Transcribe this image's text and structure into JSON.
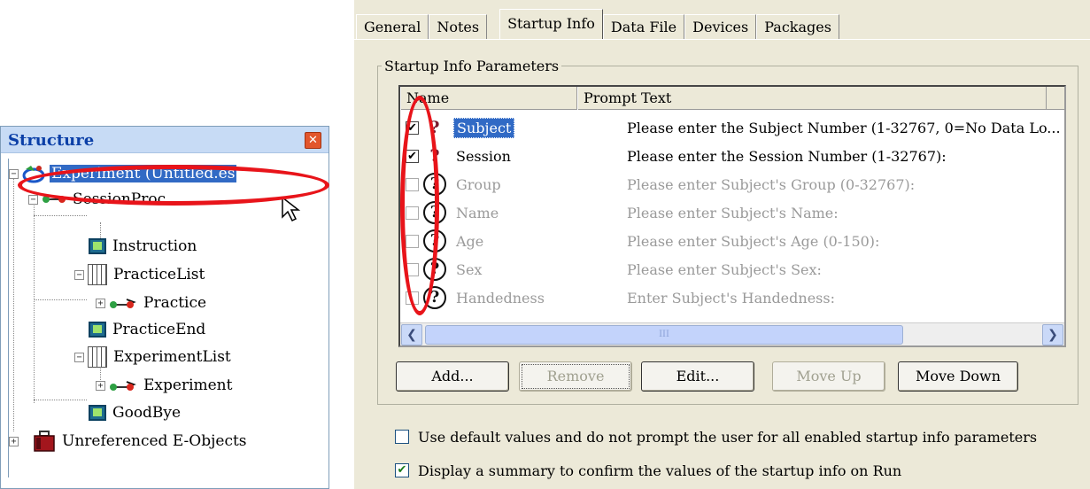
{
  "structure": {
    "title": "Structure",
    "close_glyph": "✕",
    "nodes": [
      {
        "label": "Experiment (Untitled.es",
        "icon": "experiment-icon"
      },
      {
        "label": "SessionProc",
        "icon": "procedure-icon"
      },
      {
        "label": "Instruction",
        "icon": "textdisplay-icon"
      },
      {
        "label": "PracticeList",
        "icon": "list-icon"
      },
      {
        "label": "Practice",
        "icon": "procedure-icon"
      },
      {
        "label": "PracticeEnd",
        "icon": "textdisplay-icon"
      },
      {
        "label": "ExperimentList",
        "icon": "list-icon"
      },
      {
        "label": "Experiment",
        "icon": "procedure-icon"
      },
      {
        "label": "GoodBye",
        "icon": "textdisplay-icon"
      },
      {
        "label": "Unreferenced E-Objects",
        "icon": "briefcase-icon"
      }
    ]
  },
  "tabs": [
    "General",
    "Notes",
    "Startup Info",
    "Data File",
    "Devices",
    "Packages"
  ],
  "active_tab": "Startup Info",
  "group_title": "Startup Info Parameters",
  "columns": {
    "name": "Name",
    "prompt": "Prompt Text"
  },
  "rows": [
    {
      "checked": true,
      "enabled": true,
      "name": "Subject",
      "prompt": "Please enter the Subject Number (1-32767, 0=No Data Lo..."
    },
    {
      "checked": true,
      "enabled": true,
      "name": "Session",
      "prompt": "Please enter the Session Number (1-32767):"
    },
    {
      "checked": false,
      "enabled": false,
      "name": "Group",
      "prompt": "Please enter Subject's Group (0-32767):"
    },
    {
      "checked": false,
      "enabled": false,
      "name": "Name",
      "prompt": "Please enter Subject's Name:"
    },
    {
      "checked": false,
      "enabled": false,
      "name": "Age",
      "prompt": "Please enter Subject's Age (0-150):"
    },
    {
      "checked": false,
      "enabled": false,
      "name": "Sex",
      "prompt": "Please enter Subject's Sex:"
    },
    {
      "checked": false,
      "enabled": false,
      "name": "Handedness",
      "prompt": "Enter Subject's Handedness:"
    }
  ],
  "row_glyphs": {
    "check": "✔",
    "question": "?"
  },
  "scroll": {
    "left": "❮",
    "right": "❯",
    "grip": "III"
  },
  "buttons": {
    "add": "Add...",
    "remove": "Remove",
    "edit": "Edit...",
    "move_up": "Move Up",
    "move_down": "Move Down"
  },
  "options": [
    {
      "checked": false,
      "label": "Use default values and do not prompt the user for all enabled startup info parameters"
    },
    {
      "checked": true,
      "label": "Display a summary to confirm the values of the startup info on Run"
    }
  ],
  "colors": {
    "annotation": "#e8141a",
    "selection": "#316ac5",
    "dialog": "#ece9d8"
  }
}
